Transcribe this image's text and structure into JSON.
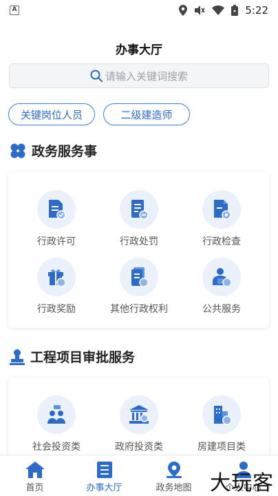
{
  "status_bar": {
    "time": "5:22",
    "left_badge": "A"
  },
  "header": {
    "title": "办事大厅"
  },
  "search": {
    "placeholder": "请输入关键词搜索"
  },
  "tags": [
    "关键岗位人员",
    "二级建造师"
  ],
  "sections": [
    {
      "title": "政务服务事",
      "items": [
        {
          "label": "行政许可",
          "icon": "permit-icon"
        },
        {
          "label": "行政处罚",
          "icon": "penalty-icon"
        },
        {
          "label": "行政检查",
          "icon": "inspection-icon"
        },
        {
          "label": "行政奖励",
          "icon": "gift-icon"
        },
        {
          "label": "其他行政权利",
          "icon": "document-icon"
        },
        {
          "label": "公共服务",
          "icon": "public-service-icon"
        }
      ]
    },
    {
      "title": "工程项目审批服务",
      "items": [
        {
          "label": "社会投资类",
          "icon": "people-icon"
        },
        {
          "label": "政府投资类",
          "icon": "government-icon"
        },
        {
          "label": "房建项目类",
          "icon": "building-icon"
        }
      ]
    }
  ],
  "bottom_nav": [
    {
      "label": "首页",
      "icon": "home-icon"
    },
    {
      "label": "办事大厅",
      "icon": "hall-icon",
      "active": true
    },
    {
      "label": "政务地图",
      "icon": "map-pin-icon"
    },
    {
      "label": "个人中心",
      "icon": "user-icon"
    }
  ],
  "watermark": "大玩客",
  "colors": {
    "accent": "#2c6cc8",
    "icon_bg": "#eaf1fb",
    "icon_fg": "#3a7bd5"
  }
}
